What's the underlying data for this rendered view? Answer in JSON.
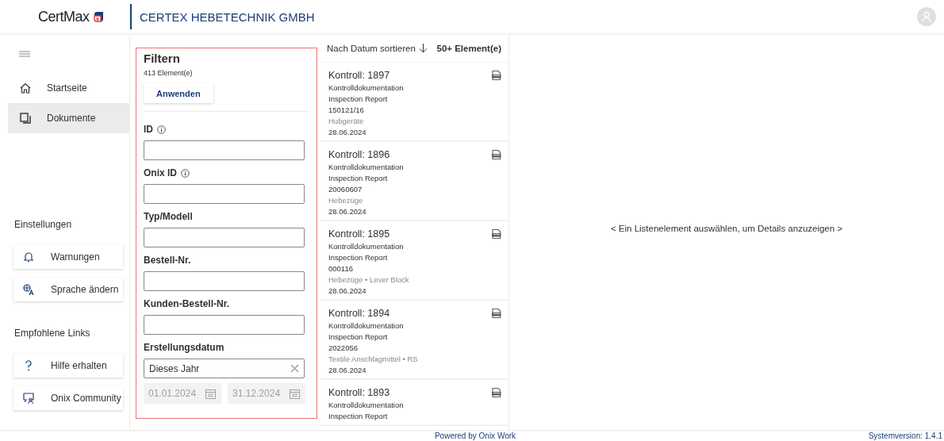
{
  "header": {
    "logo": "CertMax",
    "company": "CERTEX HEBETECHNIK GMBH"
  },
  "sidebar": {
    "nav_items": [
      {
        "label": "Startseite",
        "selected": false
      },
      {
        "label": "Dokumente",
        "selected": true
      }
    ],
    "sections": [
      {
        "heading": "Einstellungen",
        "buttons": [
          {
            "label": "Warnungen"
          },
          {
            "label": "Sprache ändern"
          }
        ]
      },
      {
        "heading": "Empfohlene Links",
        "buttons": [
          {
            "label": "Hilfe erhalten"
          },
          {
            "label": "Onix Community"
          }
        ]
      }
    ]
  },
  "filter": {
    "title": "Filtern",
    "count": "413 Element(e)",
    "apply_button": "Anwenden",
    "fields": [
      {
        "label": "ID",
        "kind": "text",
        "info": true
      },
      {
        "label": "Onix ID",
        "kind": "text",
        "info": true
      },
      {
        "label": "Typ/Modell",
        "kind": "text",
        "info": false
      },
      {
        "label": "Bestell-Nr.",
        "kind": "text",
        "info": false
      },
      {
        "label": "Kunden-Bestell-Nr.",
        "kind": "text",
        "info": false
      },
      {
        "label": "Erstellungsdatum",
        "kind": "select",
        "info": false,
        "value": "Dieses Jahr"
      }
    ],
    "date_from": "01.01.2024",
    "date_to": "31.12.2024",
    "dates_disabled": true
  },
  "list": {
    "sort_label": "Nach Datum sortieren",
    "count": "50+ Element(e)",
    "items": [
      {
        "title": "Kontroll: 1897",
        "lines": [
          "Kontrolldokumentation",
          "Inspection Report",
          "150121/16"
        ],
        "category": "Hubgeräte",
        "date": "28.06.2024"
      },
      {
        "title": "Kontroll: 1896",
        "lines": [
          "Kontrolldokumentation",
          "Inspection Report",
          "20060607"
        ],
        "category": "Hebezüge",
        "date": "28.06.2024"
      },
      {
        "title": "Kontroll: 1895",
        "lines": [
          "Kontrolldokumentation",
          "Inspection Report",
          "000116"
        ],
        "category": "Hebezüge • Lever Block",
        "date": "28.06.2024"
      },
      {
        "title": "Kontroll: 1894",
        "lines": [
          "Kontrolldokumentation",
          "Inspection Report",
          "2022056"
        ],
        "category": "Textile Anschlagmittel • RS",
        "date": "28.06.2024"
      },
      {
        "title": "Kontroll: 1893",
        "lines": [
          "Kontrolldokumentation",
          "Inspection Report"
        ]
      }
    ]
  },
  "detail": {
    "placeholder": "< Ein Listenelement auswählen, um Details anzuzeigen >"
  },
  "footer": {
    "powered": "Powered by Onix Work",
    "version": "Systemversion: 1.4.1"
  }
}
